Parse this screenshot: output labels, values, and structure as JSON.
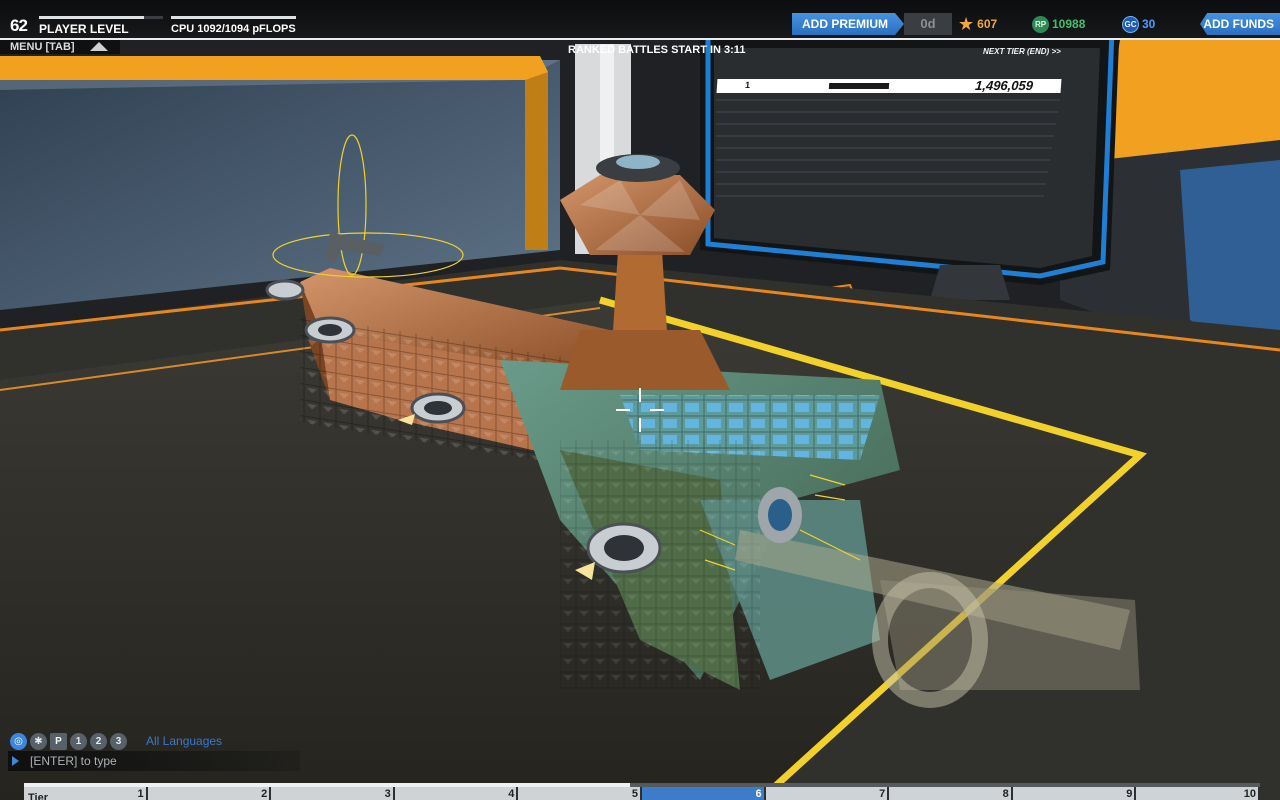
{
  "hud": {
    "player_level": "62",
    "player_level_label": "PLAYER LEVEL",
    "player_level_progress": 0.85,
    "cpu_label": "CPU 1092/1094 pFLOPS",
    "cpu_progress": 0.998,
    "menu_label": "MENU [TAB]",
    "ranked_countdown": "RANKED BATTLES START IN 3:11",
    "add_premium_label": "ADD PREMIUM",
    "premium_days": "0d",
    "tech_points": "607",
    "robits_icon": "RP",
    "robits": "10988",
    "galaxy_coins_icon": "GC",
    "galaxy_coins": "30",
    "add_funds_label": "ADD FUNDS"
  },
  "monitor": {
    "next_tier": "NEXT TIER (END) >>",
    "rank": "1",
    "score": "1,496,059"
  },
  "chat": {
    "channels": [
      {
        "name": "globe-icon",
        "glyph": ""
      },
      {
        "name": "accessibility-icon",
        "glyph": ""
      },
      {
        "name": "party-icon",
        "glyph": "P"
      },
      {
        "name": "player-1-icon",
        "glyph": "1"
      },
      {
        "name": "player-2-icon",
        "glyph": "2"
      },
      {
        "name": "player-3-icon",
        "glyph": "3"
      }
    ],
    "language_filter": "All Languages",
    "input_placeholder": "[ENTER] to type"
  },
  "tiers": {
    "title": "Tier",
    "active_tier": 6,
    "progress": 0.49,
    "labels": [
      "1",
      "2",
      "3",
      "4",
      "5",
      "6",
      "7",
      "8",
      "9",
      "10"
    ]
  },
  "colors": {
    "accent_blue": "#3d7cc9",
    "garage_orange": "#f2a020",
    "tech_point_orange": "#f2a73b",
    "robits_green": "#2d8a55"
  }
}
